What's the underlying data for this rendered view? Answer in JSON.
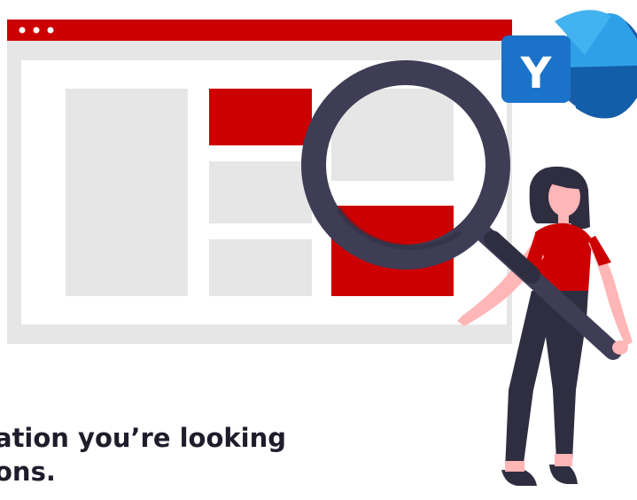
{
  "message": {
    "line1": "ation you’re looking",
    "line2": "ons."
  },
  "logo": {
    "letter": "Y"
  },
  "colors": {
    "accent": "#cc0000",
    "panel_gray": "#e6e6e6",
    "dark": "#3f3d56",
    "logo_blue": "#1a73c8"
  },
  "icons": [
    "browser-window-illustration",
    "magnifier-icon",
    "yammer-logo-icon",
    "woman-illustration"
  ]
}
